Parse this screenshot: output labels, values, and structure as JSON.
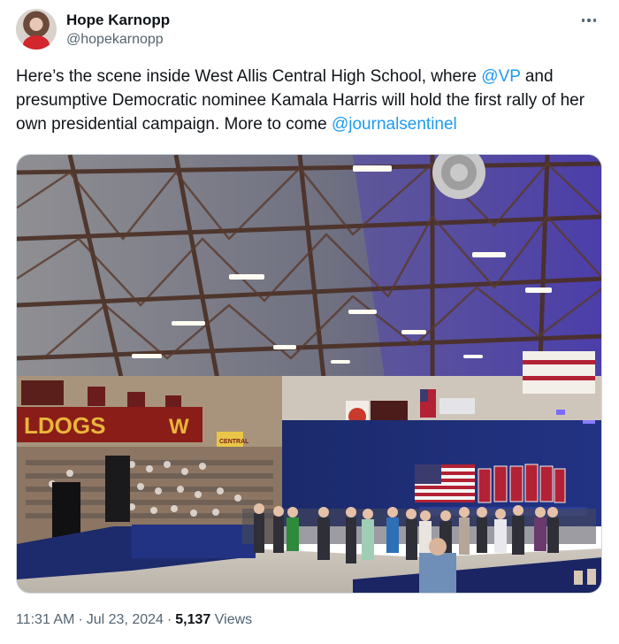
{
  "author": {
    "name": "Hope Karnopp",
    "handle": "@hopekarnopp"
  },
  "tweet": {
    "text_1": "Here’s the scene inside West Allis Central High School, where ",
    "mention_1": "@VP",
    "text_2": " and presumptive Democratic nominee Kamala Harris will hold the first rally of her own presidential campaign. More to come ",
    "mention_2": "@journalsentinel"
  },
  "media": {
    "banner_text": "LDOGS",
    "banner_suffix": "W",
    "sign_text": "CENTRAL"
  },
  "meta": {
    "time": "11:31 AM",
    "date": "Jul 23, 2024",
    "views_count": "5,137",
    "views_label": "Views",
    "dot": "·"
  },
  "colors": {
    "link": "#1d9bf0",
    "text": "#0f1419",
    "secondary": "#536471"
  }
}
